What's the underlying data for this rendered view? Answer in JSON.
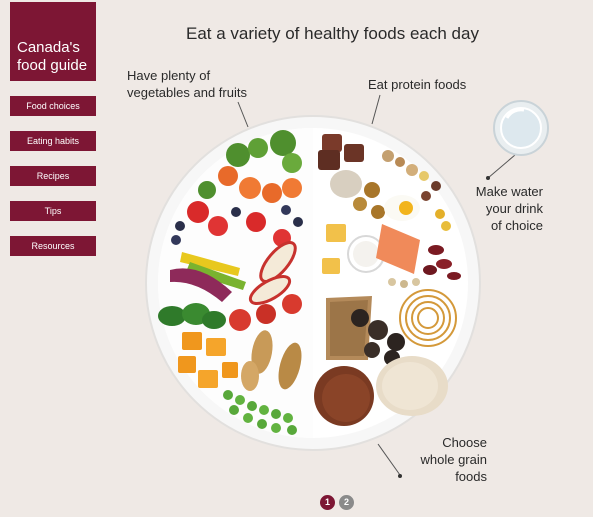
{
  "logo": {
    "line1": "Canada's",
    "line2": "food guide"
  },
  "nav": {
    "items": [
      {
        "label": "Food choices"
      },
      {
        "label": "Eating habits"
      },
      {
        "label": "Recipes"
      },
      {
        "label": "Tips"
      },
      {
        "label": "Resources"
      }
    ]
  },
  "headline": "Eat a variety of healthy foods each day",
  "labels": {
    "vegetables": {
      "line1": "Have plenty of",
      "line2": "vegetables and fruits"
    },
    "protein": {
      "line1": "Eat protein foods"
    },
    "water": {
      "line1": "Make water",
      "line2": "your drink",
      "line3": "of choice"
    },
    "grains": {
      "line1": "Choose",
      "line2": "whole grain",
      "line3": "foods"
    }
  },
  "pager": {
    "page1": "1",
    "page2": "2"
  },
  "colors": {
    "brand": "#7d1634",
    "background": "#efe9e5"
  }
}
